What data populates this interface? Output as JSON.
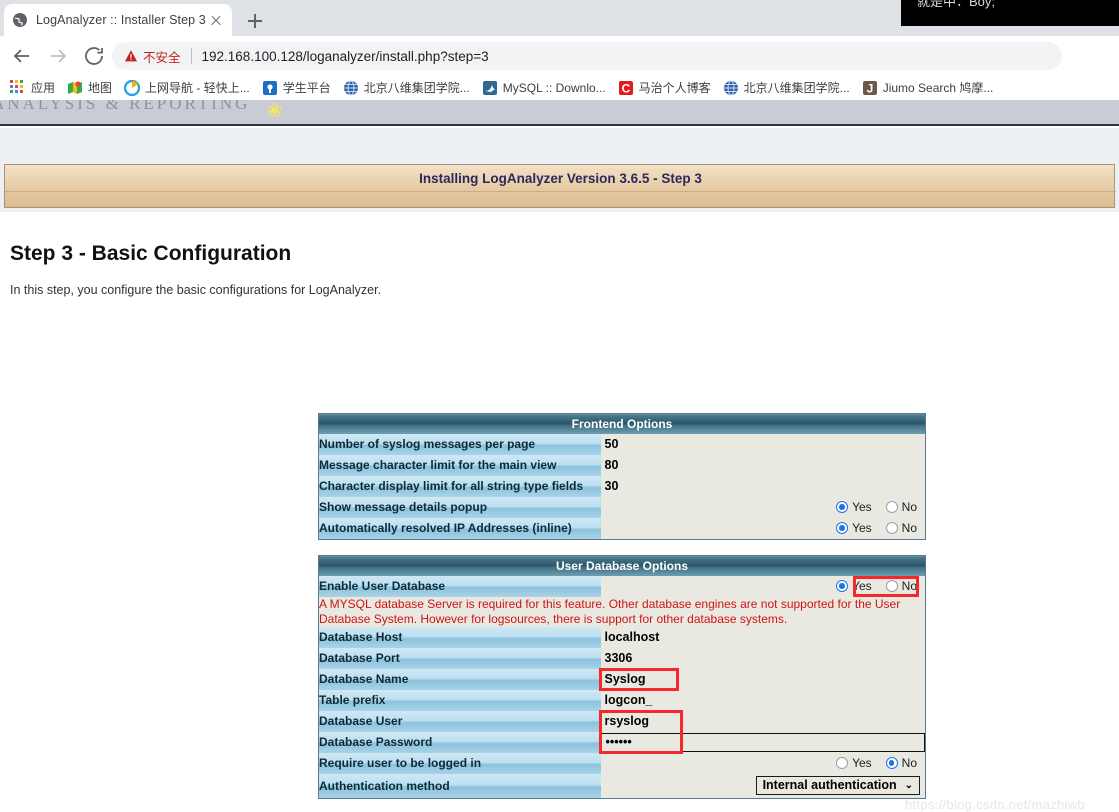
{
  "browser": {
    "tab": {
      "title": "LogAnalyzer :: Installer Step 3",
      "favicon": "globe-icon",
      "close": "×"
    },
    "new_tab_label": "+",
    "nav": {
      "back": "←",
      "forward": "→",
      "reload": "⟳"
    },
    "omnibox": {
      "security_label": "不安全",
      "security_icon": "warning-triangle-icon",
      "url": "192.168.100.128/loganalyzer/install.php?step=3",
      "key_icon": "key-icon"
    },
    "bookmarks": [
      {
        "label": "应用",
        "icon": "apps-grid-icon"
      },
      {
        "label": "地图",
        "icon": "maps-icon"
      },
      {
        "label": "上网导航 - 轻快上...",
        "icon": "browser-icon"
      },
      {
        "label": "学生平台",
        "icon": "student-icon"
      },
      {
        "label": "北京八维集团学院...",
        "icon": "globe-blue-icon"
      },
      {
        "label": "MySQL :: Downlo...",
        "icon": "mysql-dolphin-icon"
      },
      {
        "label": "马治个人博客",
        "icon": "c-letter-icon"
      },
      {
        "label": "北京八维集团学院...",
        "icon": "globe-blue-icon"
      },
      {
        "label": "Jiumo Search 鸠摩...",
        "icon": "j-letter-icon"
      }
    ]
  },
  "overlay": {
    "text": "就是中：Boy;"
  },
  "site": {
    "banner_text": "ANALYSIS  &  REPORTING",
    "banner_leaf_icon": "leaf-icon"
  },
  "installer": {
    "bar_title": "Installing LogAnalyzer Version 3.6.5 - Step 3",
    "step_heading": "Step 3 - Basic Configuration",
    "step_subtext": "In this step, you configure the basic configurations for LogAnalyzer."
  },
  "frontend": {
    "section_title": "Frontend Options",
    "rows": [
      {
        "label": "Number of syslog messages per page",
        "type": "text",
        "value": "50",
        "highlight": false
      },
      {
        "label": "Message character limit for the main view",
        "type": "text",
        "value": "80",
        "highlight": false
      },
      {
        "label": "Character display limit for all string type fields",
        "type": "text",
        "value": "30",
        "highlight": false
      },
      {
        "label": "Show message details popup",
        "type": "radio",
        "selected": "Yes",
        "yes": "Yes",
        "no": "No",
        "highlight": false
      },
      {
        "label": "Automatically resolved IP Addresses (inline)",
        "type": "radio",
        "selected": "Yes",
        "yes": "Yes",
        "no": "No",
        "highlight": false
      }
    ]
  },
  "userdb": {
    "section_title": "User Database Options",
    "enable_row": {
      "label": "Enable User Database",
      "selected": "Yes",
      "yes": "Yes",
      "no": "No",
      "highlight": true
    },
    "note": "A MYSQL database Server is required for this feature. Other database engines are not supported for the User Database System. However for logsources, there is support for other database systems.",
    "rows": [
      {
        "label": "Database Host",
        "type": "text",
        "value": "localhost",
        "highlight": false
      },
      {
        "label": "Database Port",
        "type": "text",
        "value": "3306",
        "highlight": false
      },
      {
        "label": "Database Name",
        "type": "text",
        "value": "Syslog",
        "highlight": true
      },
      {
        "label": "Table prefix",
        "type": "text",
        "value": "logcon_",
        "highlight": false
      },
      {
        "label": "Database User",
        "type": "text",
        "value": "rsyslog",
        "highlight": true
      },
      {
        "label": "Database Password",
        "type": "password",
        "value": "••••••",
        "highlight": true
      },
      {
        "label": "Require user to be logged in",
        "type": "radio",
        "selected": "No",
        "yes": "Yes",
        "no": "No",
        "highlight": false
      },
      {
        "label": "Authentication method",
        "type": "select",
        "value": "Internal authentication",
        "caret": "⌄",
        "highlight": false
      }
    ]
  },
  "watermark": {
    "text": "https://blog.csdn.net/mazhiwb"
  },
  "colors": {
    "accent_blue": "#1a73e8",
    "header_teal": "#2b5366",
    "label_blue": "#bcdff0",
    "installer_tan": "#e6cba4",
    "note_red": "#d01414",
    "highlight_red": "#f5292b"
  }
}
